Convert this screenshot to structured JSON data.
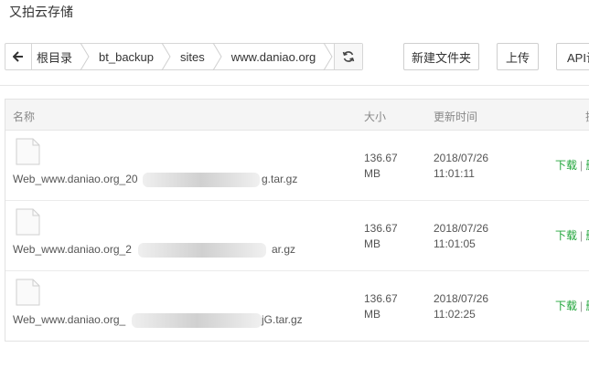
{
  "window": {
    "title": "又拍云存储"
  },
  "breadcrumb": {
    "items": [
      "根目录",
      "bt_backup",
      "sites",
      "www.daniao.org"
    ]
  },
  "toolbar": {
    "new_folder_label": "新建文件夹",
    "upload_label": "上传",
    "api_label": "API设"
  },
  "table": {
    "headers": {
      "name": "名称",
      "size": "大小",
      "time": "更新时间",
      "ops": "操"
    },
    "rows": [
      {
        "name_prefix": "Web_www.daniao.org_20",
        "name_suffix": "g.tar.gz",
        "size_value": "136.67",
        "size_unit": "MB",
        "date": "2018/07/26",
        "time": "11:01:11",
        "download": "下载",
        "more": "删"
      },
      {
        "name_prefix": "Web_www.daniao.org_2",
        "name_suffix": "ar.gz",
        "size_value": "136.67",
        "size_unit": "MB",
        "date": "2018/07/26",
        "time": "11:01:05",
        "download": "下载",
        "more": "删"
      },
      {
        "name_prefix": "Web_www.daniao.org_",
        "name_suffix": "jG.tar.gz",
        "size_value": "136.67",
        "size_unit": "MB",
        "date": "2018/07/26",
        "time": "11:02:25",
        "download": "下载",
        "more": "删"
      }
    ]
  },
  "colors": {
    "link": "#20a53a",
    "border": "#d6d6d6"
  }
}
